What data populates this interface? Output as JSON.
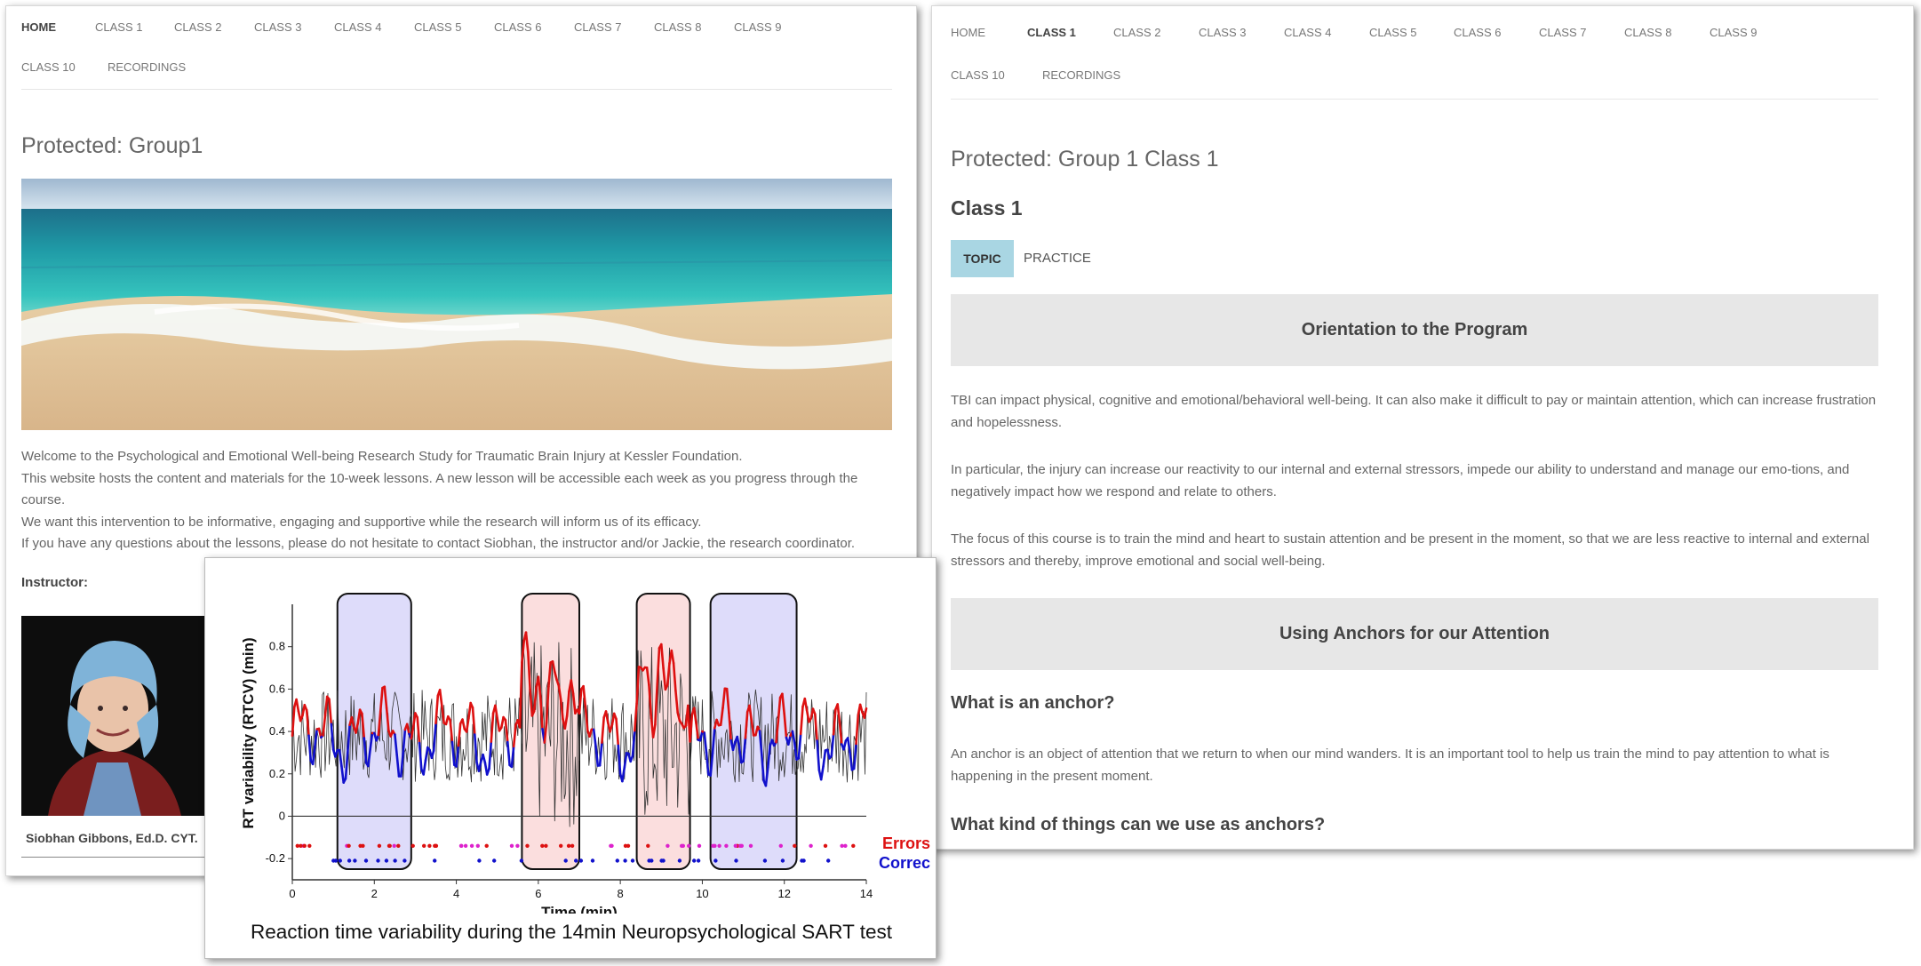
{
  "left_page": {
    "nav": [
      "HOME",
      "CLASS 1",
      "CLASS 2",
      "CLASS 3",
      "CLASS 4",
      "CLASS 5",
      "CLASS 6",
      "CLASS 7",
      "CLASS 8",
      "CLASS 9",
      "CLASS 10",
      "RECORDINGS"
    ],
    "active_nav": "HOME",
    "title": "Protected: Group1",
    "paragraphs": [
      "Welcome to the Psychological and Emotional Well-being Research Study for Traumatic Brain Injury at Kessler Foundation.",
      "This website hosts the content and materials for the 10-week lessons. A new lesson will be  accessible each week as you progress through the course.",
      "We want this intervention to be informative, engaging and supportive while the research will inform us of its efficacy.",
      "If you have any questions about the lessons, please do not hesitate to contact Siobhan, the instructor and/or Jackie, the research coordinator."
    ],
    "instructor_label": "Instructor:",
    "instructor_name": "Siobhan Gibbons, Ed.D. CYT."
  },
  "right_page": {
    "nav": [
      "HOME",
      "CLASS 1",
      "CLASS 2",
      "CLASS 3",
      "CLASS 4",
      "CLASS 5",
      "CLASS 6",
      "CLASS 7",
      "CLASS 8",
      "CLASS 9",
      "CLASS 10",
      "RECORDINGS"
    ],
    "active_nav": "CLASS 1",
    "title": "Protected: Group 1 Class 1",
    "class_heading": "Class 1",
    "tabs": [
      "TOPIC",
      "PRACTICE"
    ],
    "active_tab": "TOPIC",
    "section1_title": "Orientation to the Program",
    "section1_paragraphs": [
      "TBI can impact physical, cognitive and emotional/behavioral well-being.  It can also make it difficult to pay or maintain attention, which can increase frustration and hopelessness.",
      "In particular, the injury can increase our reactivity to our internal and external stressors,  impede our ability to understand and manage our emo-tions, and negatively impact how we respond and relate to others.",
      "The focus of this course is to train the mind and heart to sustain attention and be present in the moment, so that we are less reactive to internal and external stressors and thereby, improve emotional and social well-being."
    ],
    "section2_title": "Using Anchors for our Attention",
    "q1": "What is an anchor?",
    "q1_answer": "An anchor is an object of attention that we return to when our mind wanders. It is an important tool to help us train the mind to pay attention to what is happening in the present moment.",
    "q2": "What kind of things can we use as anchors?"
  },
  "chart_data": {
    "type": "line",
    "title": "",
    "xlabel": "Time (min)",
    "ylabel": "RT variability (RTCV) (min)",
    "xlim": [
      0,
      14
    ],
    "ylim": [
      -0.3,
      1.0
    ],
    "xticks": [
      "0",
      "2",
      "4",
      "6",
      "8",
      "10",
      "12",
      "14"
    ],
    "yticks": [
      "-0.2",
      "0",
      "0.2",
      "0.4",
      "0.6",
      "0.8"
    ],
    "legend": [
      "Errors",
      "Correct"
    ],
    "legend_display": [
      "Errors",
      "Correc"
    ],
    "legend_position": "bottom-right",
    "series_colors": {
      "raw": "#333333",
      "errors": "#dd1111",
      "correct": "#1111cc",
      "magenta": "#dd22cc"
    },
    "highlight_regions": [
      {
        "x_start": 1.1,
        "x_end": 2.9,
        "color": "blue"
      },
      {
        "x_start": 5.6,
        "x_end": 7.0,
        "color": "red"
      },
      {
        "x_start": 8.4,
        "x_end": 9.7,
        "color": "red"
      },
      {
        "x_start": 10.2,
        "x_end": 12.3,
        "color": "blue"
      }
    ],
    "caption": "Reaction time variability during the 14min Neuropsychological SART test"
  }
}
